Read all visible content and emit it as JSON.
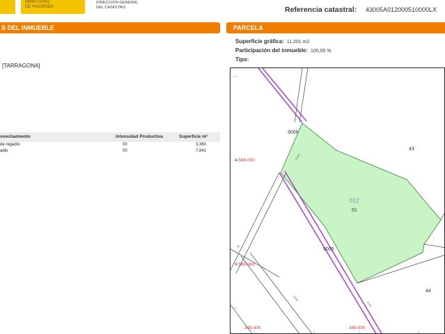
{
  "header": {
    "ministry_lines": [
      "MINISTERIO",
      "DE HACIENDA"
    ],
    "directorate_lines": [
      "DIRECCION GENERAL",
      "DEL CATASTRO"
    ],
    "ref_label": "Referencia catastral:",
    "ref_value": "43005A012000510000LX"
  },
  "left": {
    "section_title": "S DEL INMUEBLE",
    "address": "[TARRAGONA]",
    "crops": {
      "headers": [
        "ovechamiento",
        "Intensidad Productiva",
        "Superficie m²"
      ],
      "rows": [
        {
          "use": "de regadío",
          "intensity": "00",
          "area": "3.360"
        },
        {
          "use": "adio",
          "intensity": "00",
          "area": "7.841"
        }
      ]
    }
  },
  "parcel": {
    "section_title": "PARCELA",
    "surface_label": "Superficie gráfica:",
    "surface_value": "11.201 m2",
    "participation_label": "Participación del inmueble:",
    "participation_value": "100,00 %",
    "type_label": "Tipo:"
  },
  "map": {
    "parcel_code": "012",
    "parcel_number": "51",
    "neighbor_north": "43",
    "neighbor_south": "44",
    "road_upper": "9006",
    "road_lower": "9005",
    "coord_y_upper": "4.566.000",
    "coord_y_lower": "4.565.900",
    "coord_x_left": "349.400",
    "coord_x_right": "349.500",
    "colors": {
      "parcel_fill": "#c9f5c6",
      "parcel_outline": "#5a8f55",
      "road_purple": "#a64bd0",
      "coord_red": "#d23a3a"
    }
  }
}
